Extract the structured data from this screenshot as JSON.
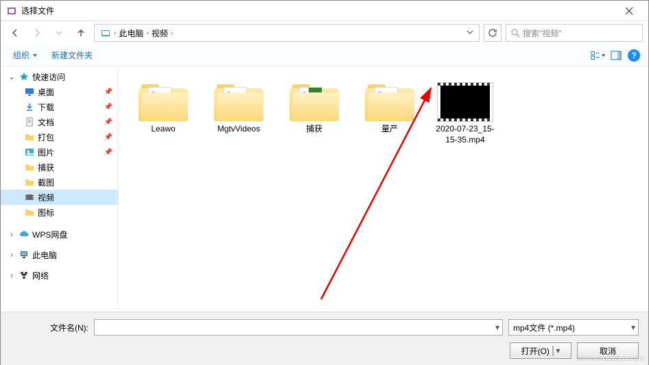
{
  "window": {
    "title": "选择文件"
  },
  "nav": {
    "breadcrumb": [
      "此电脑",
      "视频"
    ],
    "search_placeholder": "搜索\"视频\""
  },
  "toolbar": {
    "organize": "组织",
    "new_folder": "新建文件夹"
  },
  "sidebar": {
    "quick_access": "快速访问",
    "items": [
      {
        "label": "桌面",
        "pinned": true,
        "icon": "desktop"
      },
      {
        "label": "下载",
        "pinned": true,
        "icon": "download"
      },
      {
        "label": "文档",
        "pinned": true,
        "icon": "doc"
      },
      {
        "label": "打包",
        "pinned": true,
        "icon": "folder"
      },
      {
        "label": "图片",
        "pinned": true,
        "icon": "pic"
      },
      {
        "label": "捕获",
        "pinned": false,
        "icon": "folder"
      },
      {
        "label": "截图",
        "pinned": false,
        "icon": "folder"
      },
      {
        "label": "视频",
        "pinned": false,
        "icon": "video",
        "selected": true
      },
      {
        "label": "图标",
        "pinned": false,
        "icon": "folder"
      }
    ],
    "wps": "WPS网盘",
    "this_pc": "此电脑",
    "network": "网络"
  },
  "content": {
    "items": [
      {
        "type": "folder",
        "label": "Leawo"
      },
      {
        "type": "folder",
        "label": "MgtvVideos"
      },
      {
        "type": "folder-special",
        "label": "捕获"
      },
      {
        "type": "folder",
        "label": "量产"
      },
      {
        "type": "video",
        "label": "2020-07-23_15-15-35.mp4"
      }
    ]
  },
  "footer": {
    "filename_label": "文件名(N):",
    "filename_value": "",
    "filetype": "mp4文件 (*.mp4)",
    "open": "打开(O)",
    "cancel": "取消"
  },
  "watermark": "www.xiazaiba.com"
}
